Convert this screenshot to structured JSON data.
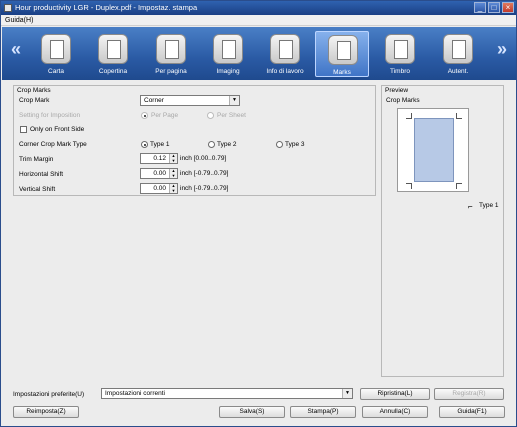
{
  "window": {
    "title": "Hour productivity LGR - Duplex.pdf - Impostaz. stampa"
  },
  "menu": {
    "guide": "Guida(H)"
  },
  "toolbar": {
    "items": [
      {
        "label": "Carta",
        "icon": "paper-icon"
      },
      {
        "label": "Copertina",
        "icon": "cover-icon"
      },
      {
        "label": "Per pagina",
        "icon": "per-page-icon"
      },
      {
        "label": "Imaging",
        "icon": "imaging-icon"
      },
      {
        "label": "Info di lavoro",
        "icon": "job-info-icon"
      },
      {
        "label": "Marks",
        "icon": "marks-icon"
      },
      {
        "label": "Timbro",
        "icon": "stamp-icon"
      },
      {
        "label": "Autent.",
        "icon": "authentication-icon"
      }
    ],
    "active": "Marks"
  },
  "crop": {
    "group_title": "Crop Marks",
    "crop_mark_label": "Crop Mark",
    "crop_mark_value": "Corner",
    "imposition_label": "Setting for Imposition",
    "per_page": "Per Page",
    "per_sheet": "Per Sheet",
    "front_only": "Only on Front Side",
    "corner_type_label": "Corner Crop Mark Type",
    "type1": "Type 1",
    "type2": "Type 2",
    "type3": "Type 3",
    "trim_label": "Trim Margin",
    "trim_value": "0.12",
    "trim_range": "inch [0.00..0.79]",
    "hshift_label": "Horizontal Shift",
    "hshift_value": "0.00",
    "hshift_range": "inch [-0.79..0.79]",
    "vshift_label": "Vertical Shift",
    "vshift_value": "0.00",
    "vshift_range": "inch [-0.79..0.79]"
  },
  "preview": {
    "group_title": "Preview",
    "sub_title": "Crop Marks",
    "type_label": "Type 1"
  },
  "footer": {
    "presets_label": "Impostazioni preferite(U)",
    "presets_value": "Impostazioni correnti",
    "restore": "Ripristina(L)",
    "register": "Registra(R)",
    "reset": "Reimposta(Z)",
    "save": "Salva(S)",
    "print": "Stampa(P)",
    "cancel": "Annulla(C)",
    "help": "Guida(F1)"
  }
}
